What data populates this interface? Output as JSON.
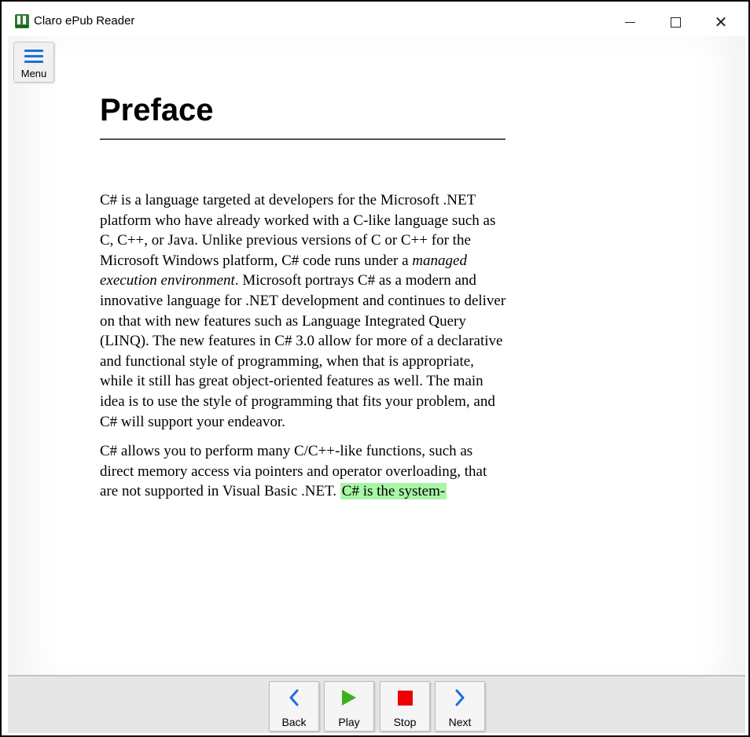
{
  "window": {
    "title": "Claro ePub Reader",
    "controls": [
      "minimize",
      "maximize",
      "close"
    ]
  },
  "menu": {
    "label": "Menu",
    "icon": "hamburger-icon",
    "color": "#1e6fd9"
  },
  "document": {
    "heading": "Preface",
    "paragraphs": [
      {
        "before_em": "C# is a language targeted at developers for the Microsoft .NET platform who have already worked with a C-like language such as C, C++, or Java. Unlike previous versions of C or C++ for the Microsoft Windows platform, C# code runs under a ",
        "em": "managed execution environment",
        "after_em": ". Microsoft portrays C# as a modern and innovative language for .NET development and continues to deliver on that with new features such as Language Integrated Query (LINQ). The new features in C# 3.0 allow for more of a declarative and functional style of programming, when that is appropriate, while it still has great object-oriented features as well. The main idea is to use the style of programming that fits your problem, and C# will support your endeavor."
      },
      {
        "text": "C# allows you to perform many C/C++-like functions, such as direct memory access via pointers and operator overloading, that are not supported in Visual Basic .NET.",
        "highlight": "C# is the system-",
        "highlight_color": "#a8f5a8"
      }
    ]
  },
  "toolbar": {
    "back": {
      "label": "Back",
      "icon": "chevron-left-icon",
      "color": "#1e6fd9"
    },
    "play": {
      "label": "Play",
      "icon": "play-icon",
      "color": "#3cb01c"
    },
    "stop": {
      "label": "Stop",
      "icon": "stop-icon",
      "color": "#ee0000"
    },
    "next": {
      "label": "Next",
      "icon": "chevron-right-icon",
      "color": "#1e6fd9"
    }
  }
}
